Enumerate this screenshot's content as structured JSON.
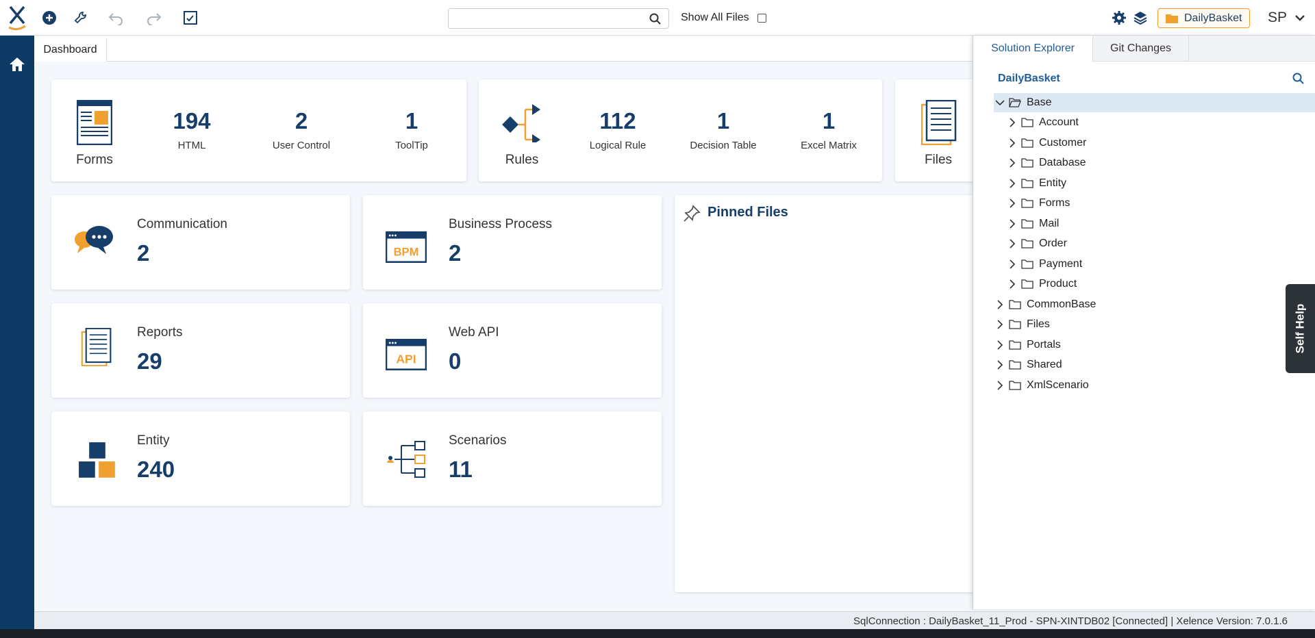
{
  "topbar": {
    "show_all_label": "Show All Files",
    "search_placeholder": "",
    "solution_button": "DailyBasket",
    "user_initials": "SP"
  },
  "tabs": {
    "dashboard": "Dashboard"
  },
  "summary_cards": [
    {
      "caption": "Forms",
      "stats": [
        {
          "value": "194",
          "label": "HTML"
        },
        {
          "value": "2",
          "label": "User Control"
        },
        {
          "value": "1",
          "label": "ToolTip"
        }
      ]
    },
    {
      "caption": "Rules",
      "stats": [
        {
          "value": "112",
          "label": "Logical Rule"
        },
        {
          "value": "1",
          "label": "Decision Table"
        },
        {
          "value": "1",
          "label": "Excel Matrix"
        }
      ]
    },
    {
      "caption": "Files"
    }
  ],
  "tiles": [
    {
      "title": "Communication",
      "value": "2"
    },
    {
      "title": "Business Process",
      "value": "2",
      "icon_text": "BPM"
    },
    {
      "title": "Reports",
      "value": "29"
    },
    {
      "title": "Web API",
      "value": "0",
      "icon_text": "API"
    },
    {
      "title": "Entity",
      "value": "240"
    },
    {
      "title": "Scenarios",
      "value": "11"
    }
  ],
  "pinned": {
    "title": "Pinned Files"
  },
  "explorer": {
    "tabs": [
      "Solution Explorer",
      "Git Changes"
    ],
    "root": "DailyBasket",
    "tree": [
      {
        "label": "Base",
        "level": 0,
        "expanded": true
      },
      {
        "label": "Account",
        "level": 1
      },
      {
        "label": "Customer",
        "level": 1
      },
      {
        "label": "Database",
        "level": 1
      },
      {
        "label": "Entity",
        "level": 1
      },
      {
        "label": "Forms",
        "level": 1
      },
      {
        "label": "Mail",
        "level": 1
      },
      {
        "label": "Order",
        "level": 1
      },
      {
        "label": "Payment",
        "level": 1
      },
      {
        "label": "Product",
        "level": 1
      },
      {
        "label": "CommonBase",
        "level": 0
      },
      {
        "label": "Files",
        "level": 0
      },
      {
        "label": "Portals",
        "level": 0
      },
      {
        "label": "Shared",
        "level": 0
      },
      {
        "label": "XmlScenario",
        "level": 0
      }
    ]
  },
  "self_help": "Self Help",
  "status": {
    "text": "SqlConnection :  DailyBasket_11_Prod -  SPN-XINTDB02  [Connected]  | Xelence Version:  7.0.1.6"
  }
}
